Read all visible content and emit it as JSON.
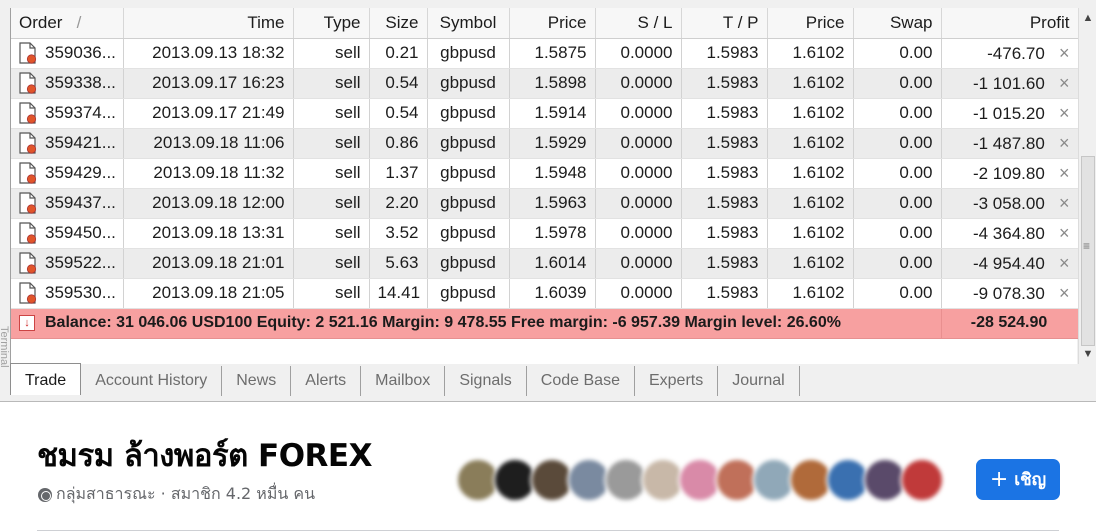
{
  "terminal": {
    "side_label": "Terminal",
    "columns": {
      "order": "Order",
      "order_sort": "/",
      "time": "Time",
      "type": "Type",
      "size": "Size",
      "symbol": "Symbol",
      "price": "Price",
      "sl": "S / L",
      "tp": "T / P",
      "price2": "Price",
      "swap": "Swap",
      "profit": "Profit"
    },
    "rows": [
      {
        "order": "359036...",
        "time": "2013.09.13 18:32",
        "type": "sell",
        "size": "0.21",
        "symbol": "gbpusd",
        "price": "1.5875",
        "sl": "0.0000",
        "tp": "1.5983",
        "price2": "1.6102",
        "swap": "0.00",
        "profit": "-476.70"
      },
      {
        "order": "359338...",
        "time": "2013.09.17 16:23",
        "type": "sell",
        "size": "0.54",
        "symbol": "gbpusd",
        "price": "1.5898",
        "sl": "0.0000",
        "tp": "1.5983",
        "price2": "1.6102",
        "swap": "0.00",
        "profit": "-1 101.60"
      },
      {
        "order": "359374...",
        "time": "2013.09.17 21:49",
        "type": "sell",
        "size": "0.54",
        "symbol": "gbpusd",
        "price": "1.5914",
        "sl": "0.0000",
        "tp": "1.5983",
        "price2": "1.6102",
        "swap": "0.00",
        "profit": "-1 015.20"
      },
      {
        "order": "359421...",
        "time": "2013.09.18 11:06",
        "type": "sell",
        "size": "0.86",
        "symbol": "gbpusd",
        "price": "1.5929",
        "sl": "0.0000",
        "tp": "1.5983",
        "price2": "1.6102",
        "swap": "0.00",
        "profit": "-1 487.80"
      },
      {
        "order": "359429...",
        "time": "2013.09.18 11:32",
        "type": "sell",
        "size": "1.37",
        "symbol": "gbpusd",
        "price": "1.5948",
        "sl": "0.0000",
        "tp": "1.5983",
        "price2": "1.6102",
        "swap": "0.00",
        "profit": "-2 109.80"
      },
      {
        "order": "359437...",
        "time": "2013.09.18 12:00",
        "type": "sell",
        "size": "2.20",
        "symbol": "gbpusd",
        "price": "1.5963",
        "sl": "0.0000",
        "tp": "1.5983",
        "price2": "1.6102",
        "swap": "0.00",
        "profit": "-3 058.00"
      },
      {
        "order": "359450...",
        "time": "2013.09.18 13:31",
        "type": "sell",
        "size": "3.52",
        "symbol": "gbpusd",
        "price": "1.5978",
        "sl": "0.0000",
        "tp": "1.5983",
        "price2": "1.6102",
        "swap": "0.00",
        "profit": "-4 364.80"
      },
      {
        "order": "359522...",
        "time": "2013.09.18 21:01",
        "type": "sell",
        "size": "5.63",
        "symbol": "gbpusd",
        "price": "1.6014",
        "sl": "0.0000",
        "tp": "1.5983",
        "price2": "1.6102",
        "swap": "0.00",
        "profit": "-4 954.40"
      },
      {
        "order": "359530...",
        "time": "2013.09.18 21:05",
        "type": "sell",
        "size": "14.41",
        "symbol": "gbpusd",
        "price": "1.6039",
        "sl": "0.0000",
        "tp": "1.5983",
        "price2": "1.6102",
        "swap": "0.00",
        "profit": "-9 078.30"
      }
    ],
    "summary": {
      "text": "Balance: 31 046.06 USD100  Equity: 2 521.16  Margin: 9 478.55  Free margin: -6 957.39  Margin level: 26.60%",
      "profit": "-28 524.90"
    },
    "close_icon": "×",
    "tabs": [
      "Trade",
      "Account History",
      "News",
      "Alerts",
      "Mailbox",
      "Signals",
      "Code Base",
      "Experts",
      "Journal"
    ],
    "colors": {
      "summary_bg": "#f7a0a0",
      "alt_row": "#ececec"
    }
  },
  "group": {
    "name": "ชมรม ล้างพอร์ต FOREX",
    "meta": "กลุ่มสาธารณะ · สมาชิก 4.2 หมื่น คน",
    "meta_icon": "globe-icon",
    "invite_plus": "+",
    "invite_label": "เชิญ",
    "invite_color": "#1b74e4"
  }
}
